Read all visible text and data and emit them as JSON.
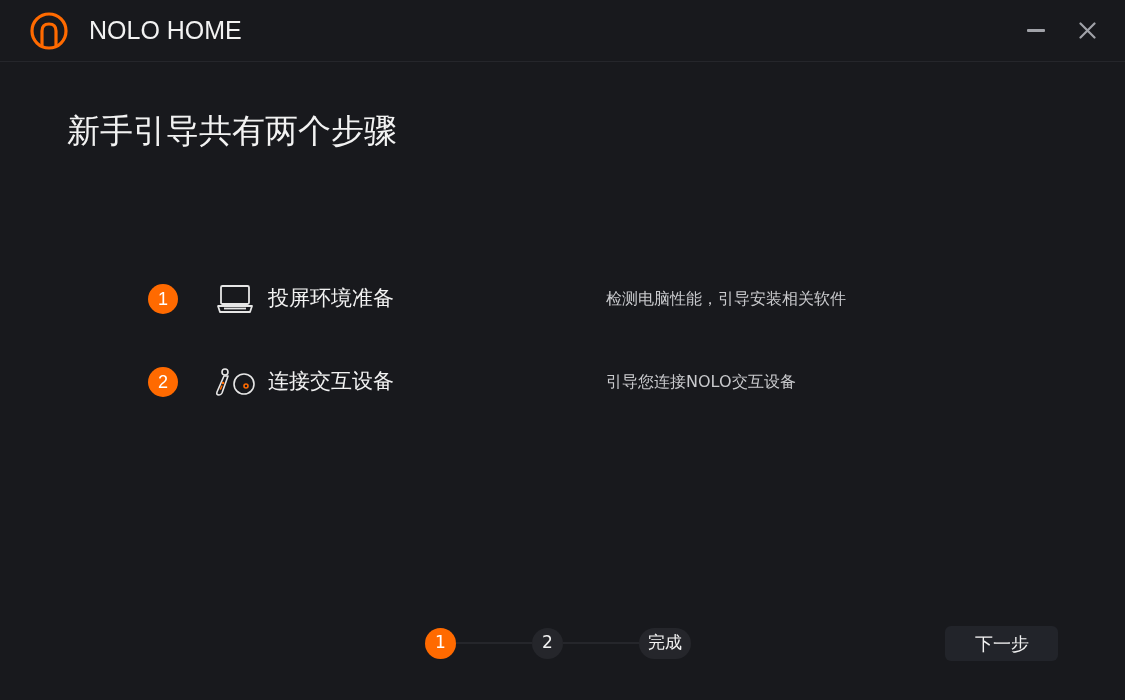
{
  "window": {
    "title": "NOLO HOME"
  },
  "heading": "新手引导共有两个步骤",
  "steps": [
    {
      "number": "1",
      "kind": "laptop",
      "title": "投屏环境准备",
      "description": "检测电脑性能，引导安装相关软件"
    },
    {
      "number": "2",
      "kind": "controller",
      "title": "连接交互设备",
      "description": "引导您连接NOLO交互设备"
    }
  ],
  "progress": [
    {
      "label": "1",
      "selected": true
    },
    {
      "label": "2",
      "selected": false
    },
    {
      "label": "完成",
      "selected": false
    }
  ],
  "next_button": "下一步"
}
